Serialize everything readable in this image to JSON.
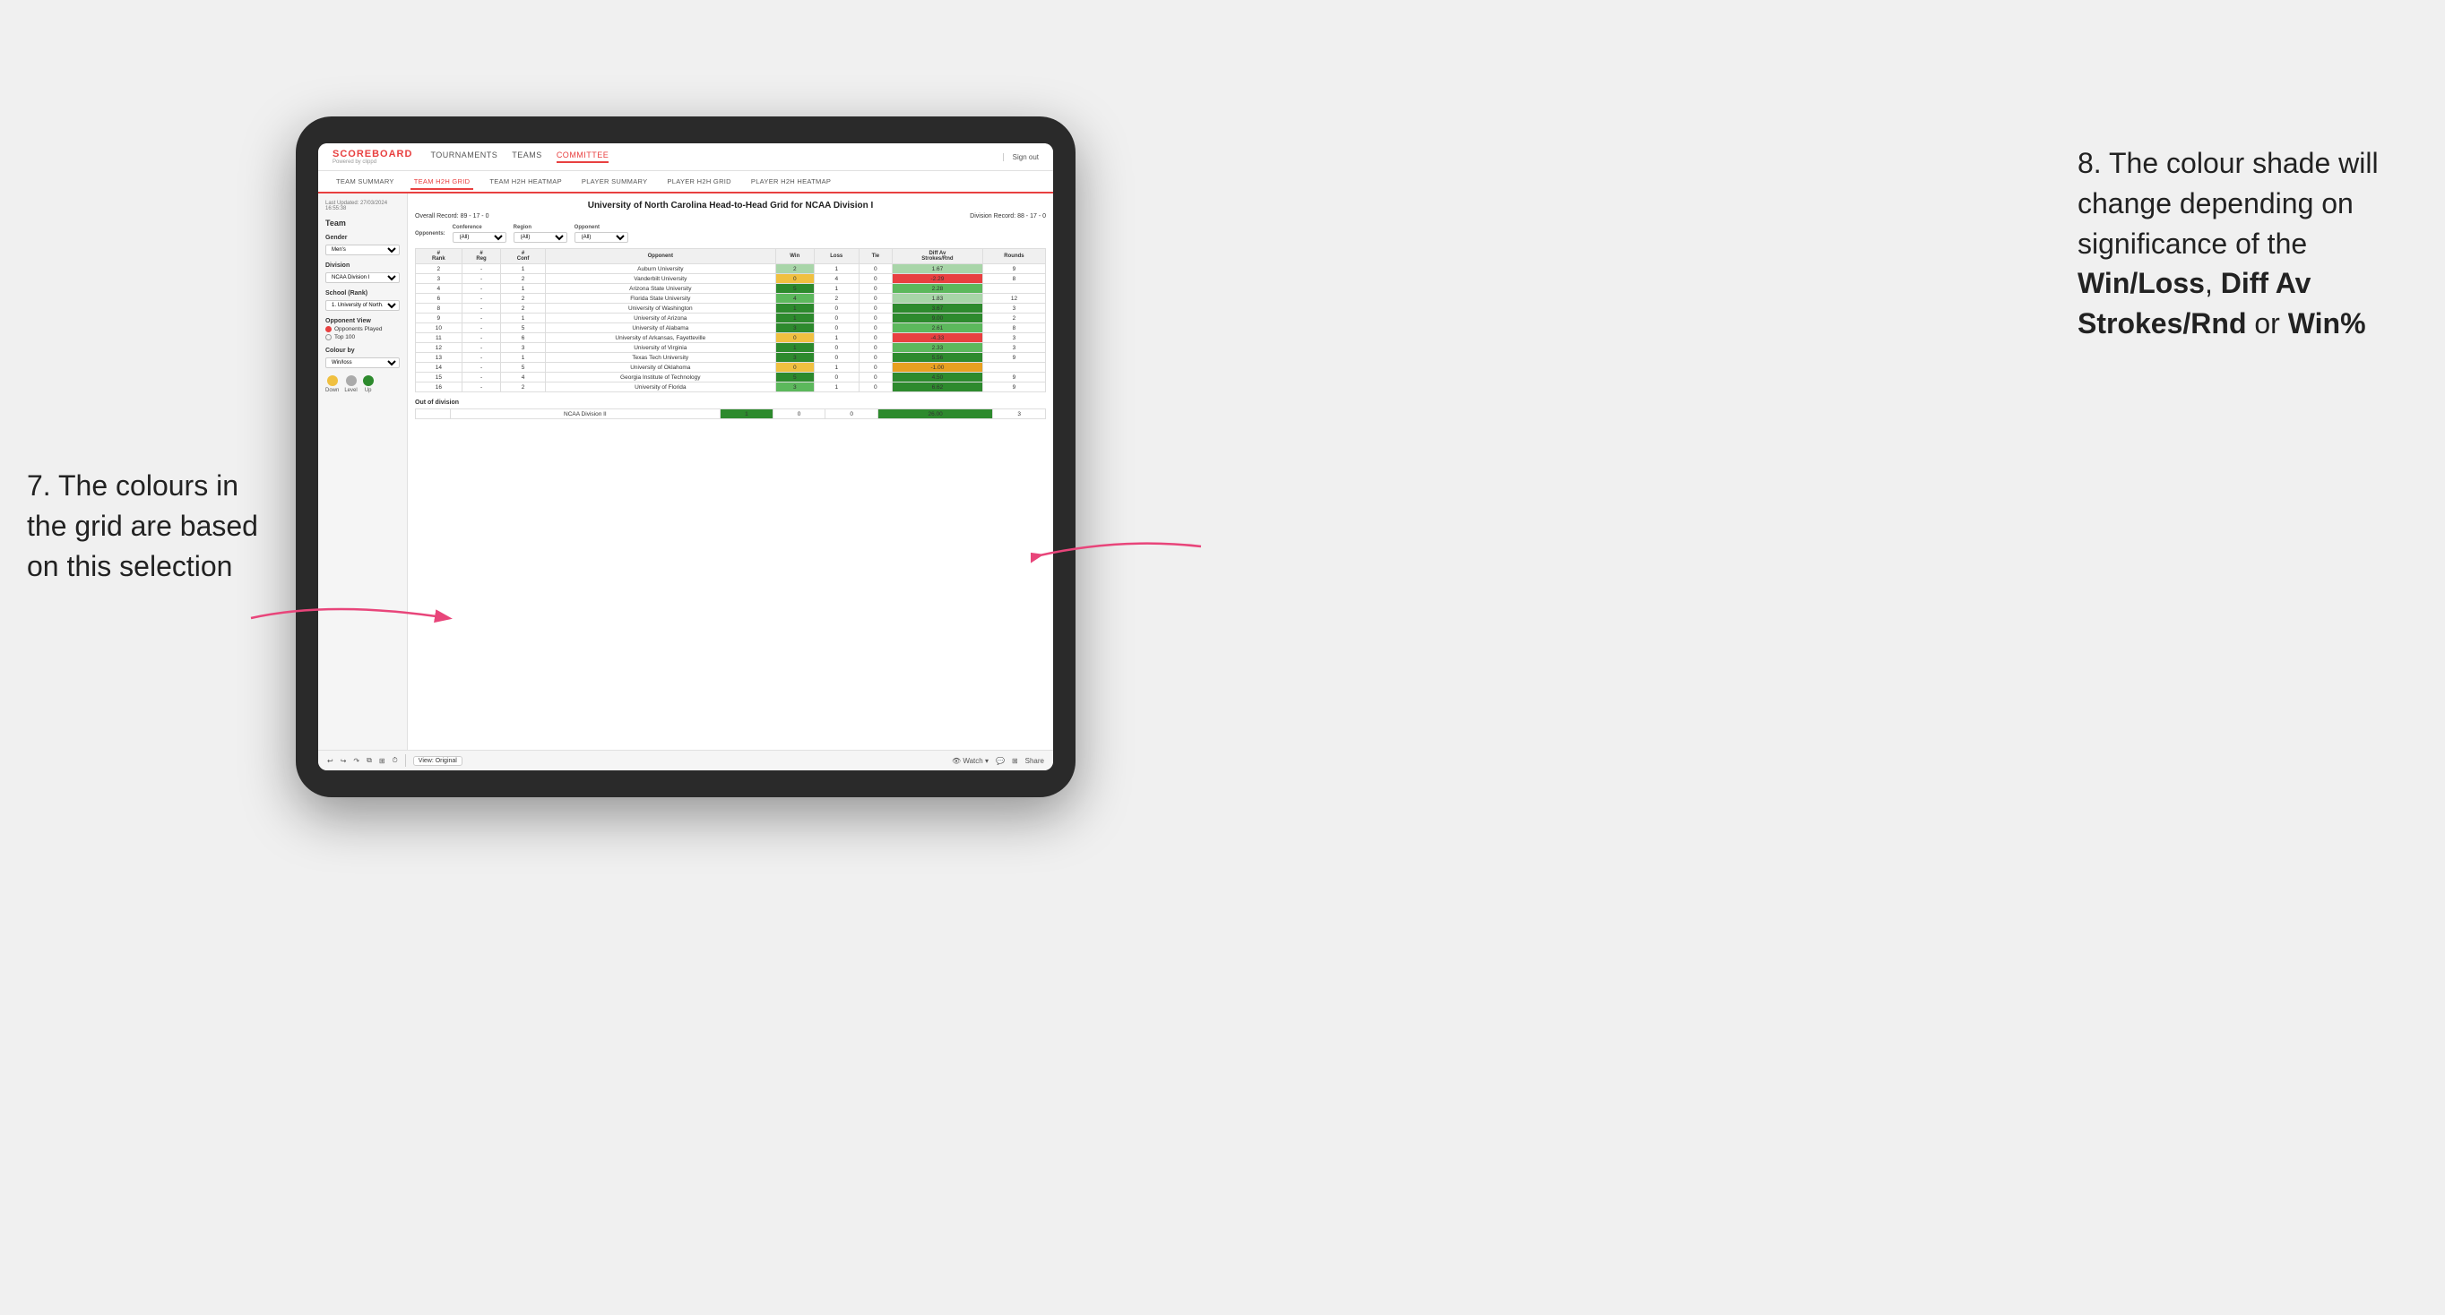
{
  "page": {
    "background": "#f0f0f0"
  },
  "annotation_left": {
    "text": "7. The colours in the grid are based on this selection"
  },
  "annotation_right": {
    "intro": "8. The colour shade will change depending on significance of the ",
    "bold1": "Win/Loss",
    "sep1": ", ",
    "bold2": "Diff Av Strokes/Rnd",
    "sep2": " or ",
    "bold3": "Win%"
  },
  "nav": {
    "logo": "SCOREBOARD",
    "logo_sub": "Powered by clippd",
    "links": [
      "TOURNAMENTS",
      "TEAMS",
      "COMMITTEE"
    ],
    "active_link": "COMMITTEE",
    "sign_out": "Sign out"
  },
  "sub_nav": {
    "items": [
      "TEAM SUMMARY",
      "TEAM H2H GRID",
      "TEAM H2H HEATMAP",
      "PLAYER SUMMARY",
      "PLAYER H2H GRID",
      "PLAYER H2H HEATMAP"
    ],
    "active": "TEAM H2H GRID"
  },
  "sidebar": {
    "timestamp": "Last Updated: 27/03/2024\n16:55:38",
    "team_label": "Team",
    "gender_label": "Gender",
    "gender_value": "Men's",
    "division_label": "Division",
    "division_value": "NCAA Division I",
    "school_label": "School (Rank)",
    "school_value": "1. University of North...",
    "opponent_view_label": "Opponent View",
    "radio_options": [
      "Opponents Played",
      "Top 100"
    ],
    "radio_selected": "Opponents Played",
    "colour_by_label": "Colour by",
    "colour_by_value": "Win/loss",
    "legend": {
      "down_label": "Down",
      "level_label": "Level",
      "up_label": "Up"
    }
  },
  "grid": {
    "title": "University of North Carolina Head-to-Head Grid for NCAA Division I",
    "overall_record": "Overall Record: 89 - 17 - 0",
    "division_record": "Division Record: 88 - 17 - 0",
    "filters": {
      "opponents_label": "Opponents:",
      "conference_label": "Conference",
      "conference_value": "(All)",
      "region_label": "Region",
      "region_value": "(All)",
      "opponent_label": "Opponent",
      "opponent_value": "(All)"
    },
    "columns": [
      "#\nRank",
      "#\nReg",
      "#\nConf",
      "Opponent",
      "Win",
      "Loss",
      "Tie",
      "Diff Av\nStrokes/Rnd",
      "Rounds"
    ],
    "rows": [
      {
        "rank": "2",
        "reg": "-",
        "conf": "1",
        "opponent": "Auburn University",
        "win": "2",
        "loss": "1",
        "tie": "0",
        "diff": "1.67",
        "rounds": "9",
        "win_color": "cell-green-light",
        "diff_color": "cell-green-light"
      },
      {
        "rank": "3",
        "reg": "-",
        "conf": "2",
        "opponent": "Vanderbilt University",
        "win": "0",
        "loss": "4",
        "tie": "0",
        "diff": "-2.29",
        "rounds": "8",
        "win_color": "cell-yellow",
        "diff_color": "cell-red"
      },
      {
        "rank": "4",
        "reg": "-",
        "conf": "1",
        "opponent": "Arizona State University",
        "win": "5",
        "loss": "1",
        "tie": "0",
        "diff": "2.28",
        "rounds": "",
        "win_color": "cell-green-dark",
        "diff_color": "cell-green-med"
      },
      {
        "rank": "6",
        "reg": "-",
        "conf": "2",
        "opponent": "Florida State University",
        "win": "4",
        "loss": "2",
        "tie": "0",
        "diff": "1.83",
        "rounds": "12",
        "win_color": "cell-green-med",
        "diff_color": "cell-green-light"
      },
      {
        "rank": "8",
        "reg": "-",
        "conf": "2",
        "opponent": "University of Washington",
        "win": "1",
        "loss": "0",
        "tie": "0",
        "diff": "3.67",
        "rounds": "3",
        "win_color": "cell-green-dark",
        "diff_color": "cell-green-dark"
      },
      {
        "rank": "9",
        "reg": "-",
        "conf": "1",
        "opponent": "University of Arizona",
        "win": "1",
        "loss": "0",
        "tie": "0",
        "diff": "9.00",
        "rounds": "2",
        "win_color": "cell-green-dark",
        "diff_color": "cell-green-dark"
      },
      {
        "rank": "10",
        "reg": "-",
        "conf": "5",
        "opponent": "University of Alabama",
        "win": "3",
        "loss": "0",
        "tie": "0",
        "diff": "2.61",
        "rounds": "8",
        "win_color": "cell-green-dark",
        "diff_color": "cell-green-med"
      },
      {
        "rank": "11",
        "reg": "-",
        "conf": "6",
        "opponent": "University of Arkansas, Fayetteville",
        "win": "0",
        "loss": "1",
        "tie": "0",
        "diff": "-4.33",
        "rounds": "3",
        "win_color": "cell-yellow",
        "diff_color": "cell-red"
      },
      {
        "rank": "12",
        "reg": "-",
        "conf": "3",
        "opponent": "University of Virginia",
        "win": "1",
        "loss": "0",
        "tie": "0",
        "diff": "2.33",
        "rounds": "3",
        "win_color": "cell-green-dark",
        "diff_color": "cell-green-med"
      },
      {
        "rank": "13",
        "reg": "-",
        "conf": "1",
        "opponent": "Texas Tech University",
        "win": "3",
        "loss": "0",
        "tie": "0",
        "diff": "5.56",
        "rounds": "9",
        "win_color": "cell-green-dark",
        "diff_color": "cell-green-dark"
      },
      {
        "rank": "14",
        "reg": "-",
        "conf": "5",
        "opponent": "University of Oklahoma",
        "win": "0",
        "loss": "1",
        "tie": "0",
        "diff": "-1.00",
        "rounds": "",
        "win_color": "cell-yellow",
        "diff_color": "cell-orange"
      },
      {
        "rank": "15",
        "reg": "-",
        "conf": "4",
        "opponent": "Georgia Institute of Technology",
        "win": "5",
        "loss": "0",
        "tie": "0",
        "diff": "4.50",
        "rounds": "9",
        "win_color": "cell-green-dark",
        "diff_color": "cell-green-dark"
      },
      {
        "rank": "16",
        "reg": "-",
        "conf": "2",
        "opponent": "University of Florida",
        "win": "3",
        "loss": "1",
        "tie": "0",
        "diff": "6.62",
        "rounds": "9",
        "win_color": "cell-green-med",
        "diff_color": "cell-green-dark"
      }
    ],
    "out_of_division_label": "Out of division",
    "out_of_division_rows": [
      {
        "opponent": "NCAA Division II",
        "win": "1",
        "loss": "0",
        "tie": "0",
        "diff": "26.00",
        "rounds": "3",
        "win_color": "cell-green-dark",
        "diff_color": "cell-green-dark"
      }
    ]
  },
  "toolbar": {
    "view_label": "View: Original",
    "watch_label": "Watch ▾",
    "share_label": "Share"
  }
}
